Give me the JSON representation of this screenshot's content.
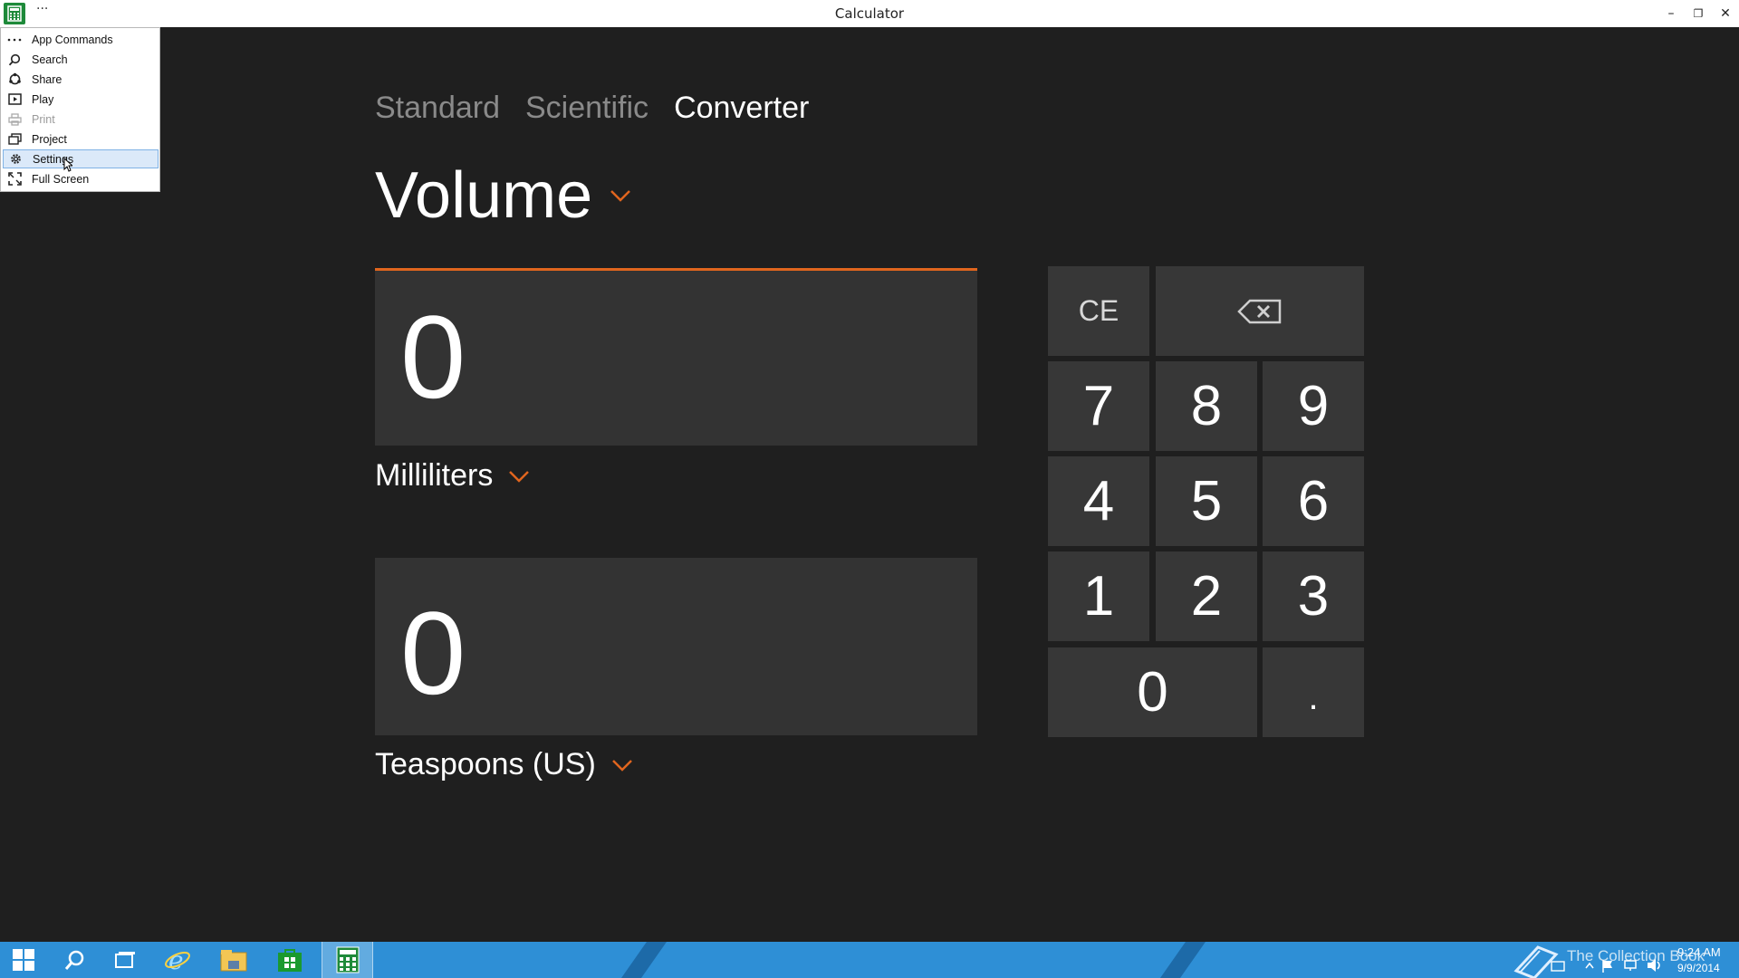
{
  "titlebar": {
    "title": "Calculator",
    "menu_dots": "···",
    "minimize": "–",
    "restore": "❐",
    "close": "✕"
  },
  "menu": {
    "items": [
      {
        "label": "App Commands",
        "icon": "more-icon",
        "disabled": false,
        "selected": false
      },
      {
        "label": "Search",
        "icon": "search-icon",
        "disabled": false,
        "selected": false
      },
      {
        "label": "Share",
        "icon": "share-icon",
        "disabled": false,
        "selected": false
      },
      {
        "label": "Play",
        "icon": "play-icon",
        "disabled": false,
        "selected": false
      },
      {
        "label": "Print",
        "icon": "print-icon",
        "disabled": true,
        "selected": false
      },
      {
        "label": "Project",
        "icon": "project-icon",
        "disabled": false,
        "selected": false
      },
      {
        "label": "Settings",
        "icon": "gear-icon",
        "disabled": false,
        "selected": true
      },
      {
        "label": "Full Screen",
        "icon": "fullscreen-icon",
        "disabled": false,
        "selected": false
      }
    ]
  },
  "tabs": [
    {
      "label": "Standard",
      "active": false
    },
    {
      "label": "Scientific",
      "active": false
    },
    {
      "label": "Converter",
      "active": true
    }
  ],
  "converter": {
    "category": "Volume",
    "from_value": "0",
    "from_unit": "Milliliters",
    "to_value": "0",
    "to_unit": "Teaspoons (US)"
  },
  "keypad": {
    "ce": "CE",
    "backspace": "⌫",
    "k7": "7",
    "k8": "8",
    "k9": "9",
    "k4": "4",
    "k5": "5",
    "k6": "6",
    "k1": "1",
    "k2": "2",
    "k3": "3",
    "k0": "0",
    "dot": "."
  },
  "taskbar": {
    "watermark": "The Collection Book",
    "time": "9:24 AM",
    "date": "9/9/2014"
  },
  "colors": {
    "accent": "#e0651e",
    "background": "#1f1f1f",
    "panel": "#333333",
    "key": "#373737",
    "taskbar": "#2e8fd6"
  }
}
